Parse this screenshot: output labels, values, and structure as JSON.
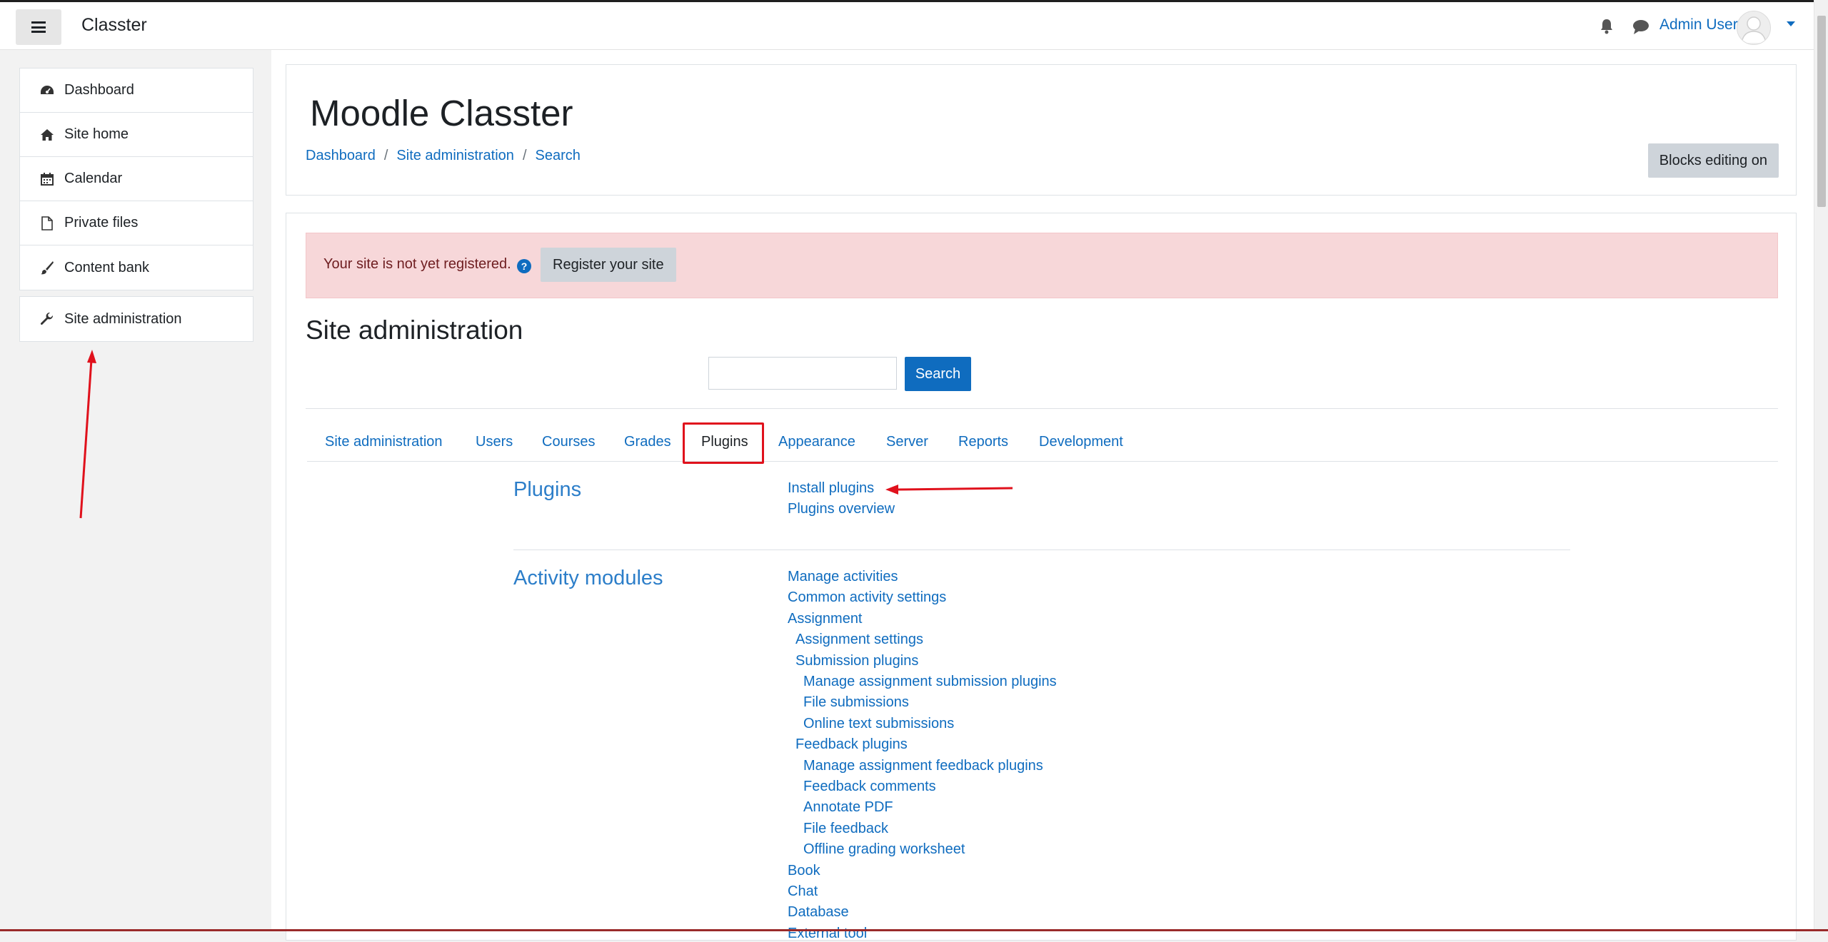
{
  "navbar": {
    "brand": "Classter",
    "username": "Admin User"
  },
  "drawer": {
    "items": [
      {
        "label": "Dashboard",
        "icon": "tachometer-icon"
      },
      {
        "label": "Site home",
        "icon": "home-icon"
      },
      {
        "label": "Calendar",
        "icon": "calendar-icon"
      },
      {
        "label": "Private files",
        "icon": "file-icon"
      },
      {
        "label": "Content bank",
        "icon": "paintbrush-icon"
      }
    ],
    "admin_item": {
      "label": "Site administration",
      "icon": "wrench-icon"
    }
  },
  "header": {
    "title": "Moodle Classter",
    "breadcrumb": [
      "Dashboard",
      "Site administration",
      "Search"
    ],
    "blocks_button": "Blocks editing on"
  },
  "alert": {
    "text": "Your site is not yet registered.",
    "button": "Register your site"
  },
  "admin": {
    "title": "Site administration",
    "search_button": "Search",
    "search_value": "",
    "tabs": [
      "Site administration",
      "Users",
      "Courses",
      "Grades",
      "Plugins",
      "Appearance",
      "Server",
      "Reports",
      "Development"
    ],
    "active_tab": "Plugins"
  },
  "categories": {
    "plugins": {
      "title": "Plugins",
      "links": [
        "Install plugins",
        "Plugins overview"
      ]
    },
    "activity_modules": {
      "title": "Activity modules",
      "links": [
        "Manage activities",
        "Common activity settings",
        "Assignment",
        "Assignment settings",
        "Submission plugins",
        "Manage assignment submission plugins",
        "File submissions",
        "Online text submissions",
        "Feedback plugins",
        "Manage assignment feedback plugins",
        "Feedback comments",
        "Annotate PDF",
        "File feedback",
        "Offline grading worksheet",
        "Book",
        "Chat",
        "Database",
        "External tool"
      ]
    }
  },
  "colors": {
    "link": "#0f6cbf",
    "alert_bg": "#f7d7d9",
    "annotation": "#e0111c"
  }
}
